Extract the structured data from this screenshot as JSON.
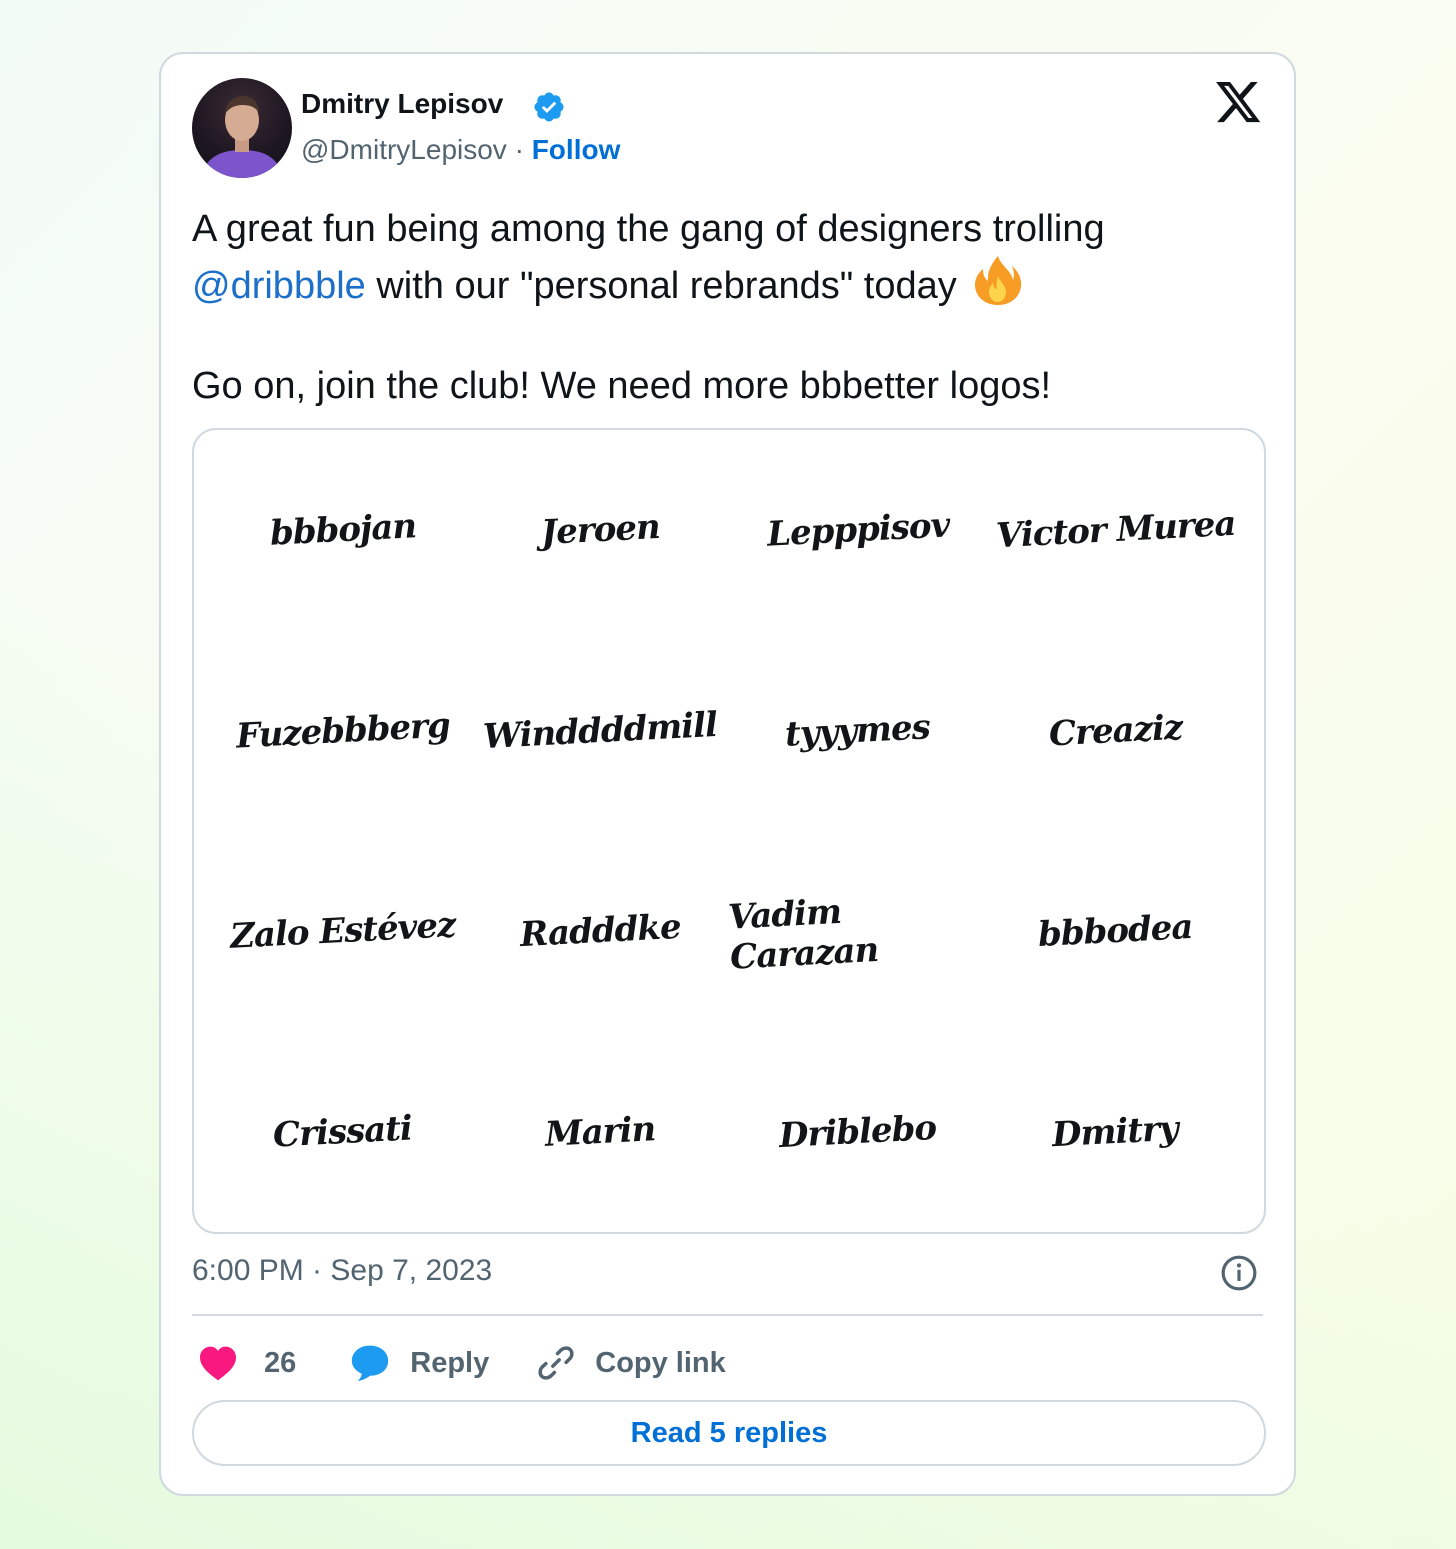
{
  "tweet": {
    "author": {
      "name": "Dmitry Lepisov",
      "handle": "@DmitryLepisov",
      "separator": "·",
      "follow_label": "Follow"
    },
    "text": {
      "line1": "A great fun being among the gang of designers trolling",
      "mention": "@dribbble",
      "line2_rest": " with our \"personal rebrands\" today",
      "line3": "Go on, join the club! We need more bbbetter logos!"
    },
    "media": {
      "logos": [
        "bbbojan",
        "Jeroen",
        "Lepppisov",
        "Victor Murea",
        "Fuzebbberg",
        "Winddddmill",
        "tyyymes",
        "Creaziz",
        "Zalo Estévez",
        "Radddke",
        "Vadim Carazan",
        "bbbodea",
        "Crissati",
        "Marin",
        "Driblebo",
        "Dmitry"
      ]
    },
    "timestamp": "6:00 PM · Sep 7, 2023",
    "actions": {
      "like_count": "26",
      "reply_label": "Reply",
      "copy_link_label": "Copy link"
    },
    "read_replies_label": "Read 5 replies"
  },
  "colors": {
    "link": "#006fd6",
    "like": "#f91880",
    "reply": "#1d9bf0",
    "verified": "#1d9bf0",
    "text_primary": "#0f1419",
    "text_secondary": "#536471"
  },
  "icons": [
    "x-logo-icon",
    "verified-badge-icon",
    "fire-emoji-icon",
    "info-icon",
    "heart-icon",
    "reply-bubble-icon",
    "link-icon"
  ]
}
